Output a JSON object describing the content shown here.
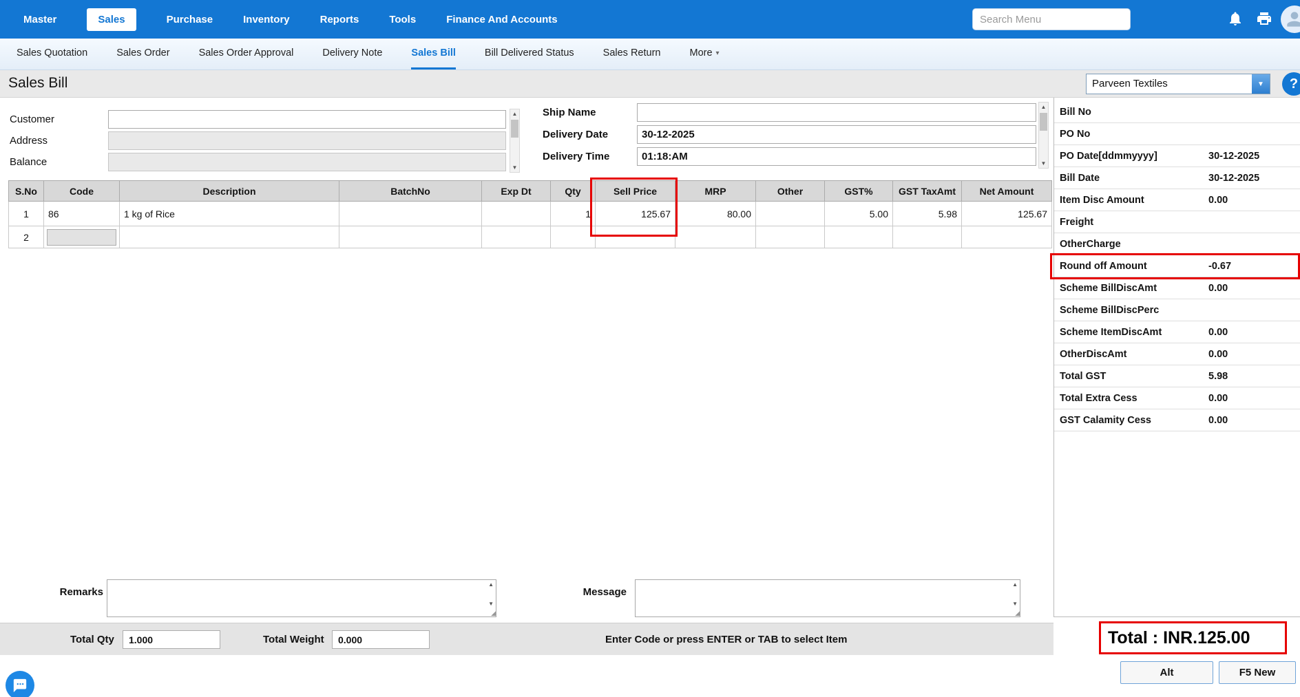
{
  "colors": {
    "accent_blue": "#1377d3",
    "highlight_red": "#e60000"
  },
  "icons": {
    "chevron_down": "▼",
    "more_caret": "▾",
    "scroll_up": "▲",
    "scroll_down": "▼",
    "help": "?",
    "resize_handle": "◢"
  },
  "topnav": {
    "search_placeholder": "Search Menu",
    "items": [
      {
        "label": "Master"
      },
      {
        "label": "Sales",
        "active": true
      },
      {
        "label": "Purchase"
      },
      {
        "label": "Inventory"
      },
      {
        "label": "Reports"
      },
      {
        "label": "Tools"
      },
      {
        "label": "Finance And Accounts"
      }
    ]
  },
  "subnav": {
    "items": [
      {
        "label": "Sales Quotation"
      },
      {
        "label": "Sales Order"
      },
      {
        "label": "Sales Order Approval"
      },
      {
        "label": "Delivery Note"
      },
      {
        "label": "Sales Bill",
        "active": true
      },
      {
        "label": "Bill Delivered Status"
      },
      {
        "label": "Sales Return"
      },
      {
        "label": "More"
      }
    ]
  },
  "header": {
    "title": "Sales Bill",
    "company": "Parveen Textiles"
  },
  "form": {
    "customer_label": "Customer",
    "address_label": "Address",
    "balance_label": "Balance",
    "ship_name_label": "Ship Name",
    "delivery_date_label": "Delivery Date",
    "delivery_date_value": "30-12-2025",
    "delivery_time_label": "Delivery Time",
    "delivery_time_value": "01:18:AM"
  },
  "items_table": {
    "columns": [
      "S.No",
      "Code",
      "Description",
      "BatchNo",
      "Exp Dt",
      "Qty",
      "Sell Price",
      "MRP",
      "Other",
      "GST%",
      "GST TaxAmt",
      "Net Amount"
    ],
    "rows": [
      {
        "sno": "1",
        "code": "86",
        "description": "1 kg of Rice",
        "batchno": "",
        "exp_dt": "",
        "qty": "1",
        "sell_price": "125.67",
        "mrp": "80.00",
        "other": "",
        "gst_pct": "5.00",
        "gst_taxamt": "5.98",
        "net_amount": "125.67"
      },
      {
        "sno": "2",
        "code": "",
        "description": "",
        "batchno": "",
        "exp_dt": "",
        "qty": "",
        "sell_price": "",
        "mrp": "",
        "other": "",
        "gst_pct": "",
        "gst_taxamt": "",
        "net_amount": ""
      }
    ]
  },
  "summary": {
    "rows": [
      {
        "label": "Bill No",
        "value": ""
      },
      {
        "label": "PO No",
        "value": ""
      },
      {
        "label": "PO Date[ddmmyyyy]",
        "value": "30-12-2025"
      },
      {
        "label": "Bill Date",
        "value": "30-12-2025"
      },
      {
        "label": "Item Disc Amount",
        "value": "0.00"
      },
      {
        "label": "Freight",
        "value": ""
      },
      {
        "label": "OtherCharge",
        "value": ""
      },
      {
        "label": "Round off Amount",
        "value": "-0.67",
        "highlighted": true
      },
      {
        "label": "Scheme BillDiscAmt",
        "value": "0.00"
      },
      {
        "label": "Scheme BillDiscPerc",
        "value": ""
      },
      {
        "label": "Scheme ItemDiscAmt",
        "value": "0.00"
      },
      {
        "label": "OtherDiscAmt",
        "value": "0.00"
      },
      {
        "label": "Total GST",
        "value": "5.98"
      },
      {
        "label": "Total Extra Cess",
        "value": "0.00"
      },
      {
        "label": "GST Calamity Cess",
        "value": "0.00"
      }
    ]
  },
  "footer": {
    "remarks_label": "Remarks",
    "message_label": "Message",
    "total_qty_label": "Total Qty",
    "total_qty_value": "1.000",
    "total_weight_label": "Total Weight",
    "total_weight_value": "0.000",
    "hint": "Enter Code or press ENTER or TAB to select Item",
    "total_label": "Total : INR.125.00",
    "alt_button": "Alt",
    "f5_button": "F5 New"
  }
}
